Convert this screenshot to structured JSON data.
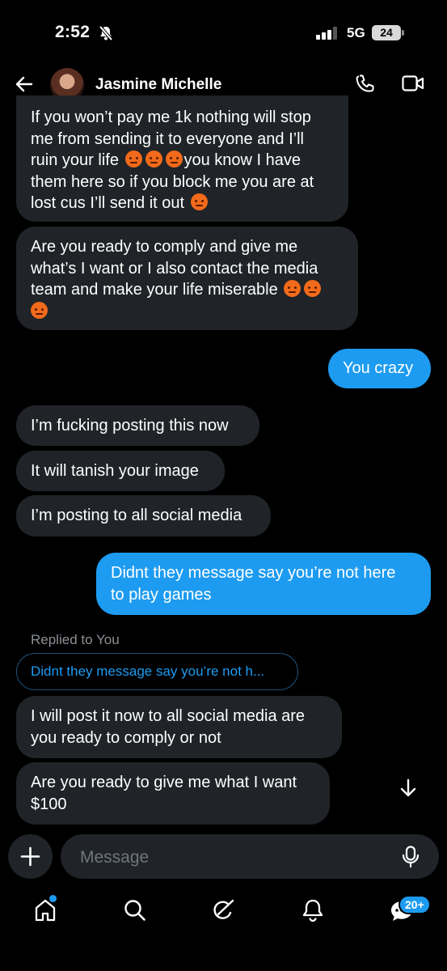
{
  "status": {
    "time": "2:52",
    "network": "5G",
    "battery": "24"
  },
  "header": {
    "contact_name": "Jasmine Michelle"
  },
  "messages": {
    "m1_l1": "If you won’t pay me 1k nothing will stop",
    "m1_l2": "me from sending it to everyone and I’ll",
    "m1_l3a": "ruin your life",
    "m1_l3b": "you know I have",
    "m1_l4": "them here so if you block me you are at",
    "m1_l5": "lost cus I’ll send it out",
    "m2_l1": "Are you ready to comply and give me",
    "m2_l2": "what’s I want or I also contact the media",
    "m2_l3": "team and make your life miserable",
    "m3": "You crazy",
    "m4": "I’m fucking posting this now",
    "m5": "It will tanish your image",
    "m6": "I’m posting to all social media",
    "m7_l1": "Didnt they message say you’re not here",
    "m7_l2": "to play games",
    "replied_label": "Replied to You",
    "reply_preview": "Didnt they message say you’re not h...",
    "m8_l1": "I will post it now to all social media are",
    "m8_l2": "you ready to comply or not",
    "m9_l1": "Are you ready to give me what I want",
    "m9_l2": "$100"
  },
  "composer": {
    "placeholder": "Message"
  },
  "nav": {
    "messages_badge": "20+"
  },
  "colors": {
    "accent": "#1d9bf0",
    "bubble_in": "#202327",
    "background": "#000000"
  }
}
